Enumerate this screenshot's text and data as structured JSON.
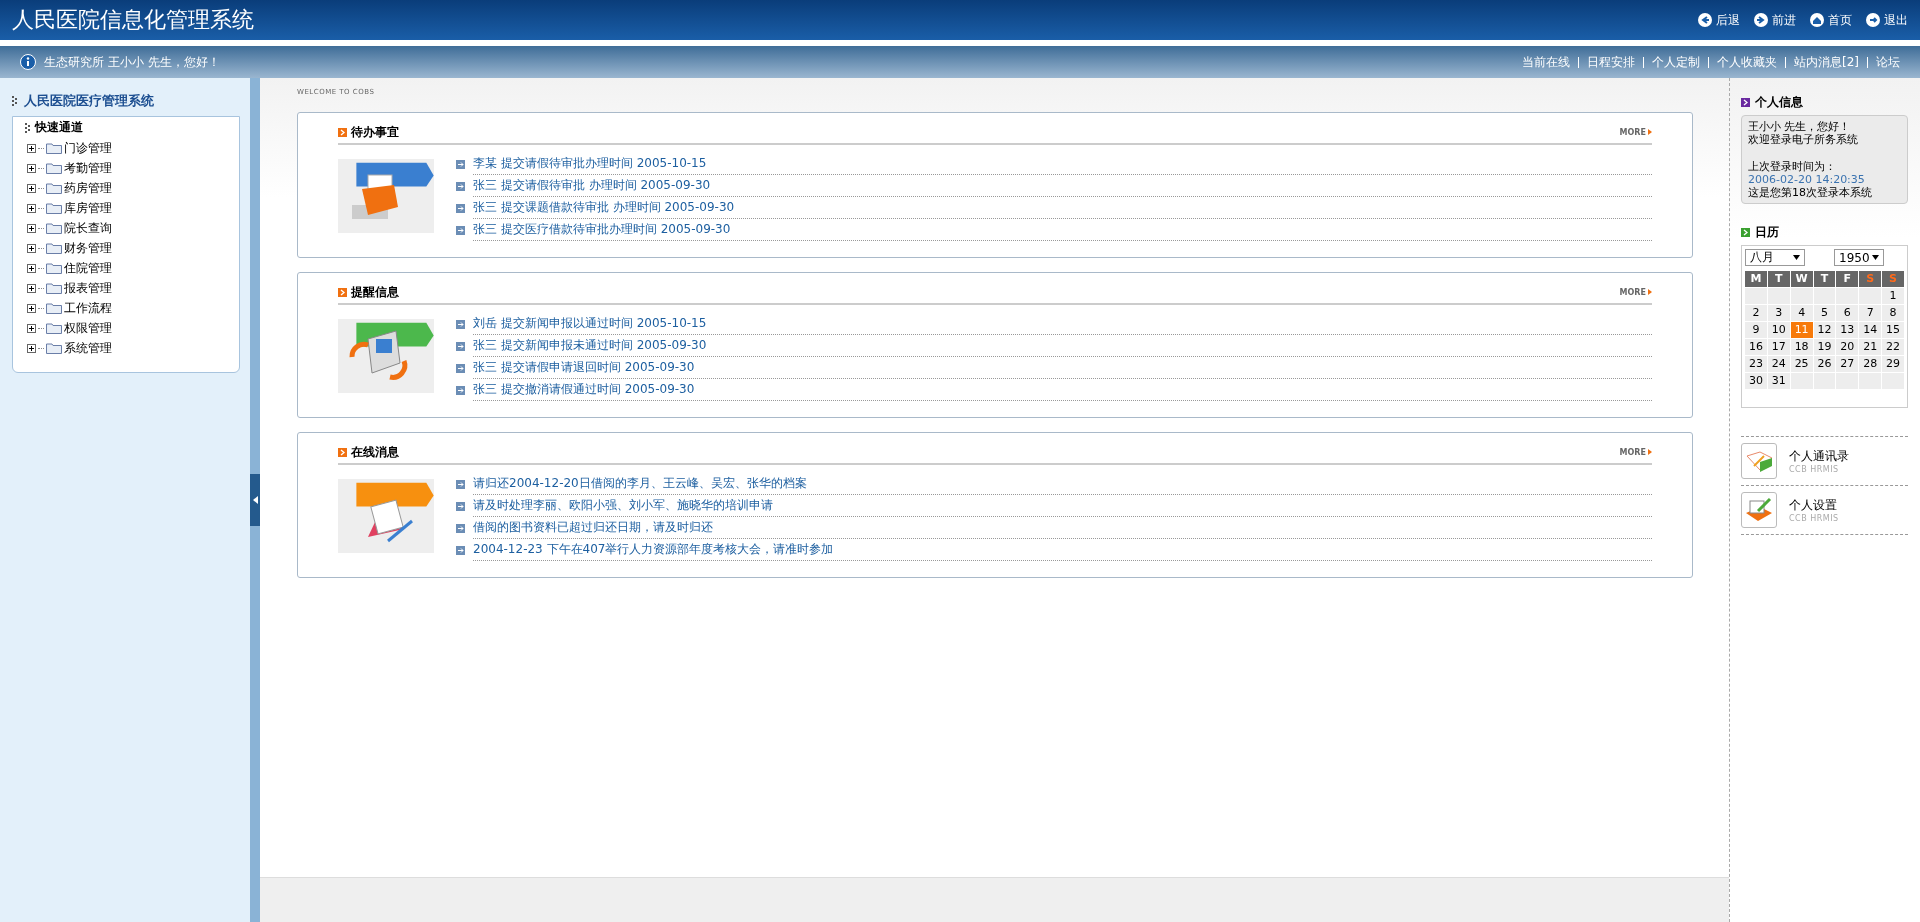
{
  "header": {
    "title": "人民医院信息化管理系统",
    "nav": [
      {
        "label": "后退",
        "kind": "back"
      },
      {
        "label": "前进",
        "kind": "forward"
      },
      {
        "label": "首页",
        "kind": "home"
      },
      {
        "label": "退出",
        "kind": "exit"
      }
    ]
  },
  "userbar": {
    "greeting": "生态研究所 王小小 先生，您好！",
    "links": [
      "当前在线",
      "日程安排",
      "个人定制",
      "个人收藏夹",
      "站内消息[2]",
      "论坛"
    ]
  },
  "sidebar": {
    "title": "人民医院医疗管理系统",
    "section": "快速通道",
    "items": [
      {
        "label": "门诊管理",
        "expanded": false
      },
      {
        "label": "考勤管理",
        "expanded": false
      },
      {
        "label": "药房管理",
        "expanded": false
      },
      {
        "label": "库房管理",
        "expanded": false
      },
      {
        "label": "院长查询",
        "expanded": false
      },
      {
        "label": "财务管理",
        "expanded": false
      },
      {
        "label": "住院管理",
        "expanded": false
      },
      {
        "label": "报表管理",
        "expanded": false
      },
      {
        "label": "工作流程",
        "expanded": false
      },
      {
        "label": "权限管理",
        "expanded": false
      },
      {
        "label": "系统管理",
        "expanded": false
      }
    ]
  },
  "welcome": "WELCOME TO COBS",
  "panels": [
    {
      "title": "待办事宜",
      "more": "MORE",
      "kind": "drawer",
      "items": [
        "李某 提交请假待审批办理时间 2005-10-15",
        "张三 提交请假待审批 办理时间 2005-09-30",
        "张三 提交课题借款待审批 办理时间 2005-09-30",
        "张三 提交医疗借款待审批办理时间 2005-09-30"
      ]
    },
    {
      "title": "提醒信息",
      "more": "MORE",
      "kind": "phone",
      "items": [
        "刘岳 提交新闻申报以通过时间 2005-10-15",
        "张三 提交新闻申报未通过时间 2005-09-30",
        "张三 提交请假申请退回时间 2005-09-30",
        "张三 提交撤消请假通过时间 2005-09-30"
      ]
    },
    {
      "title": "在线消息",
      "more": "MORE",
      "kind": "notepad",
      "items": [
        "请归还2004-12-20日借阅的李月、王云峰、吴宏、张华的档案",
        "请及时处理李丽、欧阳小强、刘小军、施晓华的培训申请",
        "借阅的图书资料已超过归还日期，请及时归还",
        "2004-12-23 下午在407举行人力资源部年度考核大会，请准时参加"
      ]
    }
  ],
  "profile": {
    "title": "个人信息",
    "greeting": "王小小 先生，您好！",
    "welcome": "欢迎登录电子所务系统",
    "last_login_label": "上次登录时间为：",
    "last_login_time": "2006-02-20 14:20:35",
    "login_count": "这是您第18次登录本系统"
  },
  "calendar": {
    "title": "日历",
    "month": "八月",
    "year": "1950",
    "weekdays": [
      {
        "label": "M",
        "weekend": false
      },
      {
        "label": "T",
        "weekend": false
      },
      {
        "label": "W",
        "weekend": false
      },
      {
        "label": "T",
        "weekend": false
      },
      {
        "label": "F",
        "weekend": false
      },
      {
        "label": "S",
        "weekend": true
      },
      {
        "label": "S",
        "weekend": true
      }
    ],
    "weeks": [
      {
        "cells": [
          {
            "kind": "blank"
          },
          {
            "kind": "blank"
          },
          {
            "kind": "blank"
          },
          {
            "kind": "blank"
          },
          {
            "kind": "blank"
          },
          {
            "kind": "blank"
          },
          {
            "kind": "day",
            "day": "1",
            "selected": false
          }
        ]
      },
      {
        "cells": [
          {
            "kind": "day",
            "day": "2",
            "selected": false
          },
          {
            "kind": "day",
            "day": "3",
            "selected": false
          },
          {
            "kind": "day",
            "day": "4",
            "selected": false
          },
          {
            "kind": "day",
            "day": "5",
            "selected": false
          },
          {
            "kind": "day",
            "day": "6",
            "selected": false
          },
          {
            "kind": "day",
            "day": "7",
            "selected": false
          },
          {
            "kind": "day",
            "day": "8",
            "selected": false
          }
        ]
      },
      {
        "cells": [
          {
            "kind": "day",
            "day": "9",
            "selected": false
          },
          {
            "kind": "day",
            "day": "10",
            "selected": false
          },
          {
            "kind": "day",
            "day": "11",
            "selected": true
          },
          {
            "kind": "day",
            "day": "12",
            "selected": false
          },
          {
            "kind": "day",
            "day": "13",
            "selected": false
          },
          {
            "kind": "day",
            "day": "14",
            "selected": false
          },
          {
            "kind": "day",
            "day": "15",
            "selected": false
          }
        ]
      },
      {
        "cells": [
          {
            "kind": "day",
            "day": "16",
            "selected": false
          },
          {
            "kind": "day",
            "day": "17",
            "selected": false
          },
          {
            "kind": "day",
            "day": "18",
            "selected": false
          },
          {
            "kind": "day",
            "day": "19",
            "selected": false
          },
          {
            "kind": "day",
            "day": "20",
            "selected": false
          },
          {
            "kind": "day",
            "day": "21",
            "selected": false
          },
          {
            "kind": "day",
            "day": "22",
            "selected": false
          }
        ]
      },
      {
        "cells": [
          {
            "kind": "day",
            "day": "23",
            "selected": false
          },
          {
            "kind": "day",
            "day": "24",
            "selected": false
          },
          {
            "kind": "day",
            "day": "25",
            "selected": false
          },
          {
            "kind": "day",
            "day": "26",
            "selected": false
          },
          {
            "kind": "day",
            "day": "27",
            "selected": false
          },
          {
            "kind": "day",
            "day": "28",
            "selected": false
          },
          {
            "kind": "day",
            "day": "29",
            "selected": false
          }
        ]
      },
      {
        "cells": [
          {
            "kind": "day",
            "day": "30",
            "selected": false
          },
          {
            "kind": "day",
            "day": "31",
            "selected": false
          },
          {
            "kind": "blank"
          },
          {
            "kind": "blank"
          },
          {
            "kind": "blank"
          },
          {
            "kind": "blank"
          },
          {
            "kind": "blank"
          }
        ]
      }
    ]
  },
  "shortcuts": [
    {
      "label": "个人通讯录",
      "sub": "CCB HRMIS",
      "kind": "book"
    },
    {
      "label": "个人设置",
      "sub": "CCB HRMIS",
      "kind": "settings"
    }
  ]
}
